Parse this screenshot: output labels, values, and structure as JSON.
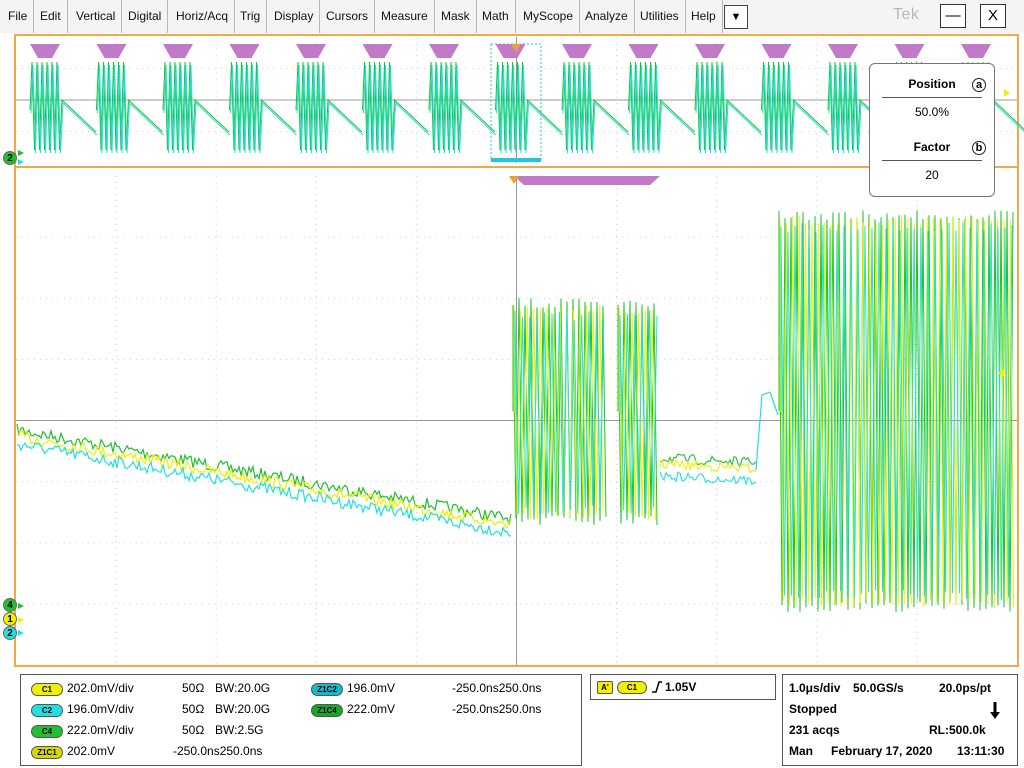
{
  "menu": {
    "items": [
      "File",
      "Edit",
      "Vertical",
      "Digital",
      "Horiz/Acq",
      "Trig",
      "Display",
      "Cursors",
      "Measure",
      "Mask",
      "Math",
      "MyScope",
      "Analyze",
      "Utilities",
      "Help"
    ],
    "dropdown_glyph": "▼",
    "logo": "Tek",
    "minimize_glyph": "—",
    "close_glyph": "X"
  },
  "zoom_box": {
    "position_label": "Position",
    "position_value": "50.0%",
    "position_knob": "a",
    "factor_label": "Factor",
    "factor_value": "20",
    "factor_knob": "b"
  },
  "handles": {
    "overview_ref": "2",
    "ch4": "4",
    "ch1": "1",
    "ch2": "2"
  },
  "colors": {
    "ch1": "#f0f000",
    "ch2": "#20e0e0",
    "ch4": "#20c030",
    "mask": "#c07ac8",
    "trigger": "#f0a030",
    "frame": "#f0a848"
  },
  "channels": {
    "c1": {
      "badge": "C1",
      "scale": "202.0mV/div",
      "imp": "50Ω",
      "bw": "BW:20.0G"
    },
    "c2": {
      "badge": "C2",
      "scale": "196.0mV/div",
      "imp": "50Ω",
      "bw": "BW:20.0G"
    },
    "c4": {
      "badge": "C4",
      "scale": "222.0mV/div",
      "imp": "50Ω",
      "bw": "BW:2.5G"
    },
    "z1c1": {
      "badge": "Z1C1",
      "scale": "202.0mV",
      "time": "-250.0ns250.0ns"
    },
    "z1c2": {
      "badge": "Z1C2",
      "scale": "196.0mV",
      "time": "-250.0ns250.0ns"
    },
    "z1c4": {
      "badge": "Z1C4",
      "scale": "222.0mV",
      "time": "-250.0ns250.0ns"
    }
  },
  "trigger": {
    "a_badge": "A'",
    "source": "C1",
    "level": "1.05V"
  },
  "acq": {
    "timebase": "1.0μs/div",
    "samplerate": "50.0GS/s",
    "resolution": "20.0ps/pt",
    "state": "Stopped",
    "acqs": "231 acqs",
    "record": "RL:500.0k",
    "mode": "Man",
    "date": "February 17, 2020",
    "time": "13:11:30"
  }
}
